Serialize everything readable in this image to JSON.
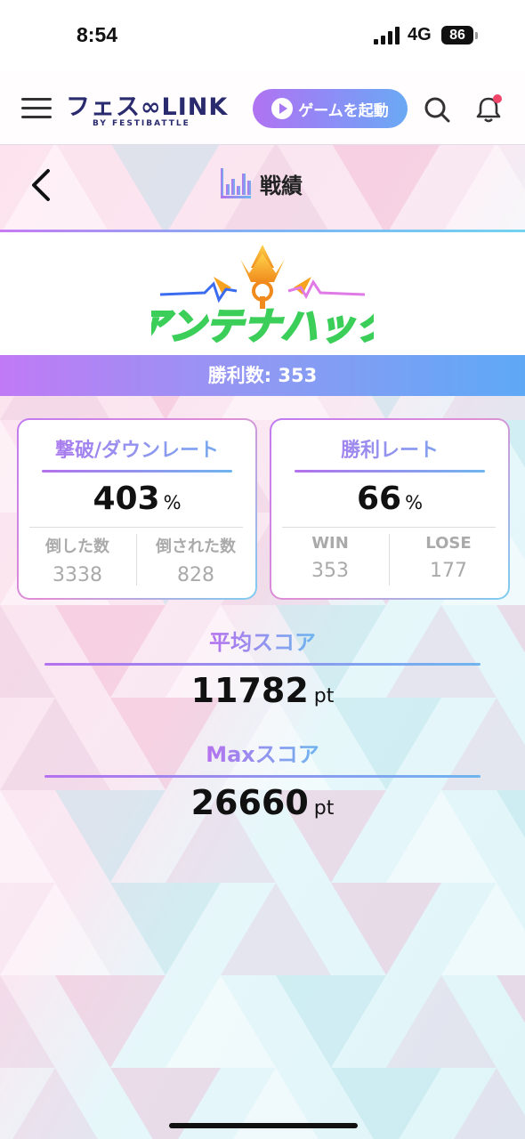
{
  "status_bar": {
    "time": "8:54",
    "network": "4G",
    "battery": "86"
  },
  "app_bar": {
    "logo_text": "フェス∞LINK",
    "logo_sub": "BY FESTIBATTLE",
    "launch_button": "ゲームを起動"
  },
  "page": {
    "title": "戦績"
  },
  "game": {
    "name": "アンテナハック",
    "wins_label": "勝利数: 353"
  },
  "cards": [
    {
      "title": "撃破/ダウンレート",
      "value": "403",
      "unit": "%",
      "left": {
        "label": "倒した数",
        "value": "3338"
      },
      "right": {
        "label": "倒された数",
        "value": "828"
      }
    },
    {
      "title": "勝利レート",
      "value": "66",
      "unit": "%",
      "left": {
        "label": "WIN",
        "value": "353"
      },
      "right": {
        "label": "LOSE",
        "value": "177"
      }
    }
  ],
  "avg_score": {
    "label": "平均スコア",
    "value": "11782",
    "unit": "pt"
  },
  "max_score": {
    "label": "Maxスコア",
    "value": "26660",
    "unit": "pt"
  },
  "colors": {
    "accent_purple": "#b571ee",
    "accent_blue": "#6fb5ef",
    "notification_dot": "#f0446b"
  }
}
